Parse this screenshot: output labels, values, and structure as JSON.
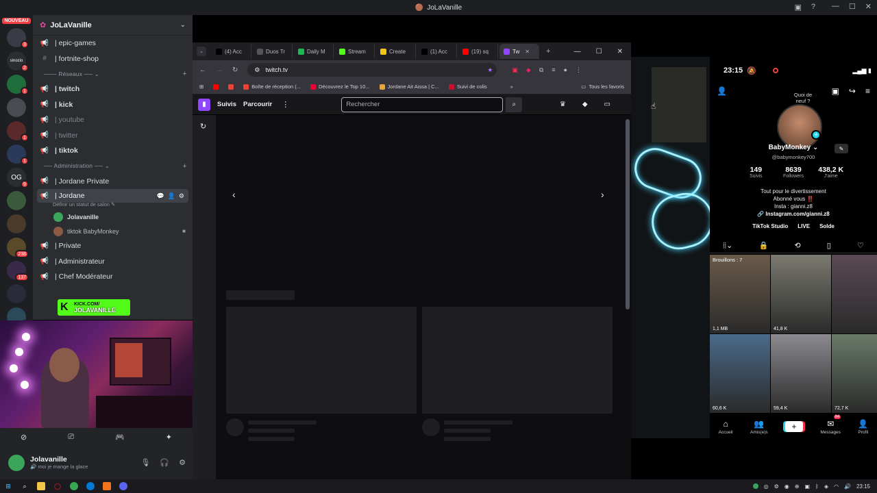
{
  "titlebar": {
    "title": "JoLaVanille",
    "inbox_icon": "inbox-icon",
    "help_icon": "help-icon"
  },
  "rail": {
    "new_badge": "NOUVEAU",
    "servers": [
      {
        "label": "",
        "badge": "3",
        "color": "#3b3b45"
      },
      {
        "label": "sinozio",
        "badge": "2",
        "color": "#2b2d31"
      },
      {
        "label": "",
        "badge": "1",
        "color": "#1e6d3b"
      },
      {
        "label": "",
        "badge": "",
        "color": "#4a4a52"
      },
      {
        "label": "",
        "badge": "1",
        "color": "#5a2a2a"
      },
      {
        "label": "",
        "badge": "1",
        "color": "#2a3a5a"
      },
      {
        "label": "OG",
        "badge": "9",
        "color": "#2b2d31"
      },
      {
        "label": "",
        "badge": "",
        "color": "#3b5a3b"
      },
      {
        "label": "",
        "badge": "",
        "color": "#4a3a2a"
      },
      {
        "label": "",
        "badge": "238",
        "color": "#5a4a2a"
      },
      {
        "label": "",
        "badge": "137",
        "color": "#3a2a4a"
      },
      {
        "label": "",
        "badge": "",
        "color": "#2a2a3a"
      },
      {
        "label": "",
        "badge": "1",
        "color": "#2a4a5a"
      }
    ]
  },
  "channels": {
    "server_name": "JoLaVanille",
    "top": [
      {
        "label": "epic-games",
        "icon": "🔊"
      },
      {
        "label": "fortnite-shop",
        "icon": "#"
      }
    ],
    "cat_reseaux": "─── Réseaux ── ⌄",
    "reseaux": [
      {
        "label": "| twitch",
        "muted": false
      },
      {
        "label": "| kick",
        "muted": false
      },
      {
        "label": "| youtube",
        "muted": true
      },
      {
        "label": "| twitter",
        "muted": true
      },
      {
        "label": "| tiktok",
        "muted": false
      }
    ],
    "cat_admin": "── Administration ── ⌄",
    "admin_top": "| Jordane Private",
    "active_channel": "| Jordane",
    "active_status": "Définir un statut de salon ✎",
    "voice_users": [
      {
        "name": "Jolavanille"
      },
      {
        "name": "tiktok BabyMonkey"
      }
    ],
    "admin_rest": [
      {
        "label": "| Private"
      },
      {
        "label": "| Administrateur"
      },
      {
        "label": "| Chef Modérateur"
      }
    ]
  },
  "kick_banner": {
    "line1": "KICK.COM/",
    "line2": "JOLAVANILLE"
  },
  "user_panel": {
    "name": "Jolavanille",
    "status": "moi je mange la glace"
  },
  "browser": {
    "tabs": [
      {
        "label": "(4) Acc",
        "color": "#000000"
      },
      {
        "label": "Duos Tr",
        "color": "#555555"
      },
      {
        "label": "Daily M",
        "color": "#1db954"
      },
      {
        "label": "Stream",
        "color": "#53fc18"
      },
      {
        "label": "Create",
        "color": "#f5c518"
      },
      {
        "label": "(1) Acc",
        "color": "#000000"
      },
      {
        "label": "(19) sq",
        "color": "#ff0000"
      },
      {
        "label": "Tw",
        "color": "#9146ff"
      }
    ],
    "url": "twitch.tv",
    "bookmarks": [
      {
        "label": "",
        "color": "#ff0000"
      },
      {
        "label": "",
        "color": "#ea4335"
      },
      {
        "label": "Boîte de réception (...",
        "color": "#ea4335"
      },
      {
        "label": "Découvrez le Top 10...",
        "color": "#e03"
      },
      {
        "label": "Jordane Ait Aissa | C...",
        "color": "#e8a33d"
      },
      {
        "label": "Suivi de colis",
        "color": "#c8102e"
      }
    ],
    "all_favorites": "Tous les favoris"
  },
  "twitch": {
    "nav_following": "Suivis",
    "nav_browse": "Parcourir",
    "search_placeholder": "Rechercher"
  },
  "tiktok": {
    "time": "23:15",
    "bubble": "Quoi de neuf ?",
    "name": "BabyMonkey",
    "handle": "@babymonkey700",
    "stats": [
      {
        "n": "149",
        "l": "Suivis"
      },
      {
        "n": "8639",
        "l": "Followers"
      },
      {
        "n": "438,2 K",
        "l": "J'aime"
      }
    ],
    "bio1": "Tout pour le divertissement",
    "bio2": "Abonné vous ‼️",
    "bio3": "Insta : gianni.z8",
    "link": "🔗 Instagram.com/gianni.z8",
    "links2": [
      "TikTok Studio",
      "LIVE",
      "Solde"
    ],
    "drafts": "Brouillons : 7",
    "grid_views": [
      "1,1 MB",
      "41,8 K",
      "",
      "60,6 K",
      "59,4 K",
      "72,7 K"
    ],
    "nav": [
      {
        "label": "Accueil",
        "icon": "⌂"
      },
      {
        "label": "Amis(e)s",
        "icon": "👥"
      },
      {
        "label": "",
        "icon": "+"
      },
      {
        "label": "Messages",
        "icon": "✉",
        "badge": "84"
      },
      {
        "label": "Profil",
        "icon": "👤"
      }
    ]
  },
  "taskbar": {
    "time": "23:15"
  }
}
